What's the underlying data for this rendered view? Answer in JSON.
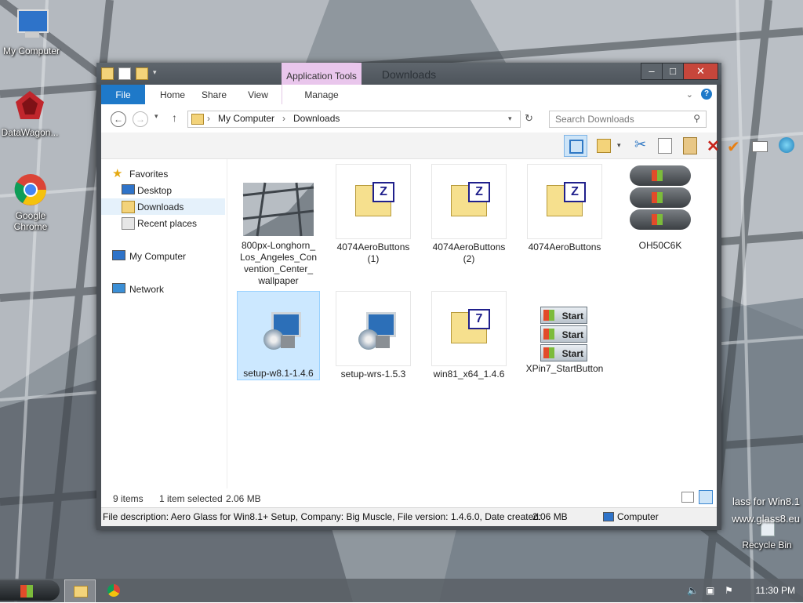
{
  "desktop": {
    "icons": [
      {
        "label": "My Computer"
      },
      {
        "label": "DataWagon..."
      },
      {
        "label": "Google Chrome"
      },
      {
        "label": "Recycle Bin"
      }
    ],
    "watermark_line1": "lass for Win8.1",
    "watermark_line2": "www.glass8.eu"
  },
  "window": {
    "title": "Downloads",
    "context_tab": "Application Tools",
    "ribbon_tabs": [
      "File",
      "Home",
      "Share",
      "View",
      "Manage"
    ],
    "address": {
      "root": "My Computer",
      "folder": "Downloads"
    },
    "search_placeholder": "Search Downloads",
    "nav": {
      "favorites": "Favorites",
      "desktop": "Desktop",
      "downloads": "Downloads",
      "recent": "Recent places",
      "computer": "My Computer",
      "network": "Network"
    },
    "files": [
      {
        "name": "800px-Longhorn_ Los_Angeles_Con vention_Center_ wallpaper",
        "type": "image"
      },
      {
        "name": "4074AeroButtons (1)",
        "type": "zip"
      },
      {
        "name": "4074AeroButtons (2)",
        "type": "zip"
      },
      {
        "name": "4074AeroButtons",
        "type": "zip"
      },
      {
        "name": "OH50C6K",
        "type": "winbuttons"
      },
      {
        "name": "setup-w8.1-1.4.6",
        "type": "setup",
        "selected": true
      },
      {
        "name": "setup-wrs-1.5.3",
        "type": "setup"
      },
      {
        "name": "win81_x64_1.4.6",
        "type": "7z"
      },
      {
        "name": "XPin7_StartButton",
        "type": "startbuttons"
      }
    ],
    "status": {
      "count": "9 items",
      "selected": "1 item selected",
      "size": "2.06 MB"
    },
    "details_bar": {
      "description": "File description: Aero Glass for Win8.1+ Setup, Company: Big Muscle, File version: 1.4.6.0, Date created:",
      "size": "2.06 MB",
      "location": "Computer"
    },
    "start_label": "Start"
  },
  "taskbar": {
    "time": "11:30 PM"
  }
}
